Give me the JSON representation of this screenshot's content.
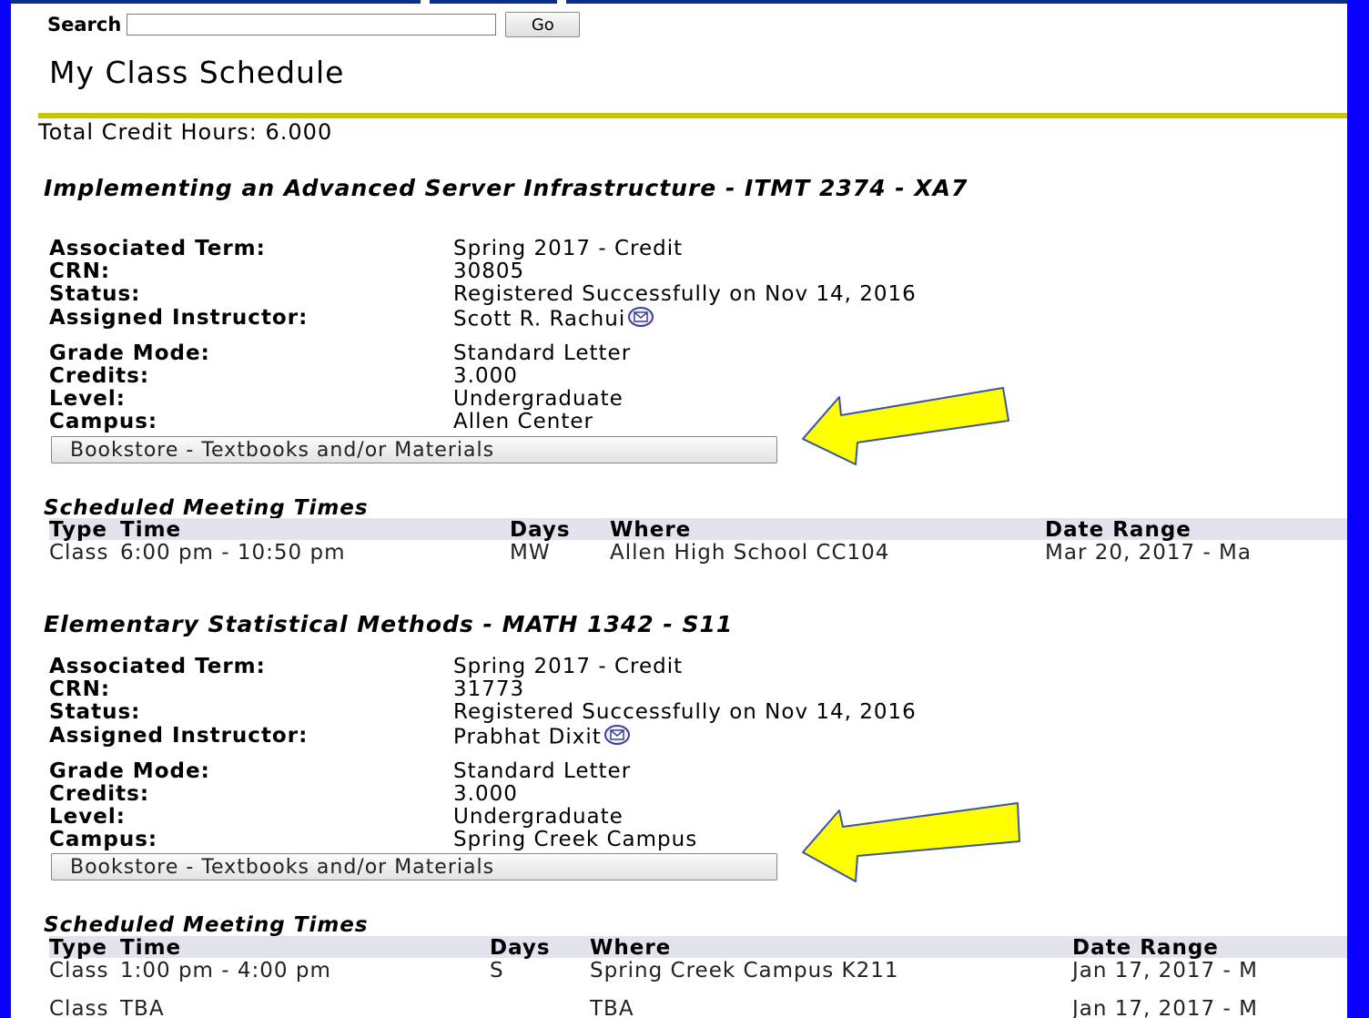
{
  "search": {
    "label": "Search",
    "value": "",
    "go_label": "Go"
  },
  "page_title": "My Class Schedule",
  "total_credit_hours": "Total Credit Hours: 6.000",
  "labels": {
    "term": "Associated Term:",
    "crn": "CRN:",
    "status": "Status:",
    "instructor": "Assigned Instructor:",
    "grade_mode": "Grade Mode:",
    "credits": "Credits:",
    "level": "Level:",
    "campus": "Campus:"
  },
  "bookstore_label": "Bookstore - Textbooks and/or Materials",
  "meeting_heading": "Scheduled Meeting Times",
  "meeting_columns": {
    "type": "Type",
    "time": "Time",
    "days": "Days",
    "where": "Where",
    "date_range": "Date Range"
  },
  "courses": [
    {
      "title": "Implementing an Advanced Server Infrastructure - ITMT 2374 - XA7",
      "term": "Spring 2017 - Credit",
      "crn": "30805",
      "status": "Registered Successfully on Nov 14, 2016",
      "instructor": "Scott R. Rachui",
      "grade_mode": "Standard Letter",
      "credits": "3.000",
      "level": "Undergraduate",
      "campus": "Allen Center",
      "meetings": [
        {
          "type": "Class",
          "time": "6:00 pm - 10:50 pm",
          "days": "MW",
          "where": "Allen High School CC104",
          "date_range": "Mar 20, 2017 - Ma"
        }
      ]
    },
    {
      "title": "Elementary Statistical Methods - MATH 1342 - S11",
      "term": "Spring 2017 - Credit",
      "crn": "31773",
      "status": "Registered Successfully on Nov 14, 2016",
      "instructor": "Prabhat Dixit",
      "grade_mode": "Standard Letter",
      "credits": "3.000",
      "level": "Undergraduate",
      "campus": "Spring Creek Campus",
      "meetings": [
        {
          "type": "Class",
          "time": "1:00 pm - 4:00 pm",
          "days": "S",
          "where": "Spring Creek Campus K211",
          "date_range": "Jan 17, 2017 - M"
        },
        {
          "type": "Class",
          "time": "TBA",
          "days": "",
          "where": "TBA",
          "date_range": "Jan 17, 2017 - M"
        }
      ]
    }
  ],
  "colors": {
    "frame": "#0a00ff",
    "rule": "#c9c300",
    "arrow_fill": "#ffff00",
    "arrow_stroke": "#3b55a0",
    "table_header": "#e3e3ee"
  }
}
